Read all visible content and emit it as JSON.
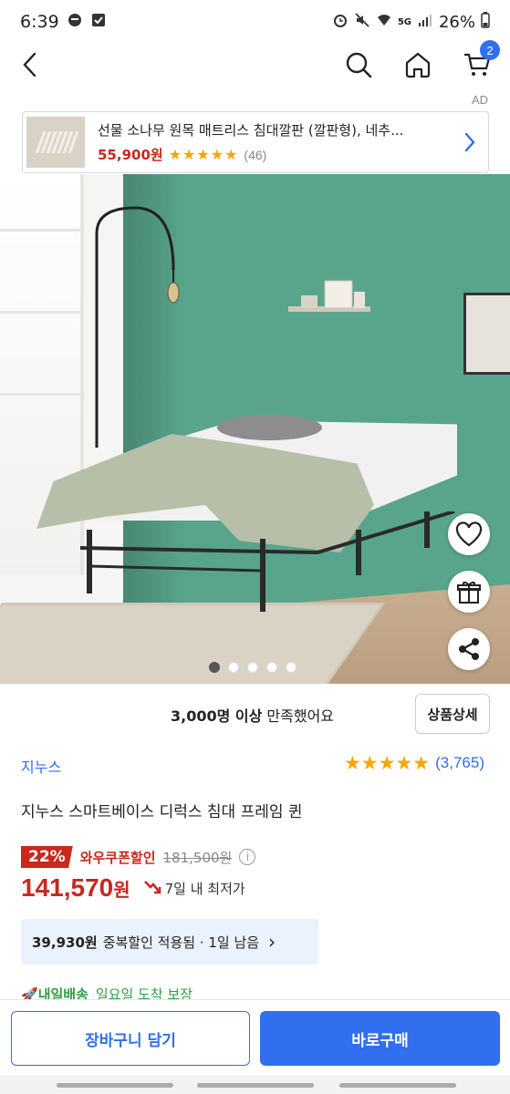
{
  "status_bar": {
    "time": "6:39",
    "battery": "26%",
    "network": "5G"
  },
  "header": {
    "cart_count": "2"
  },
  "ad": {
    "label": "AD",
    "title": "선물 소나무 원목 매트리스 침대깔판 (깔판형), 네추...",
    "price": "55,900원",
    "stars": "★★★★★",
    "review_count": "(46)"
  },
  "gallery": {
    "total": 5,
    "active_index": 0
  },
  "satisfaction": {
    "strong": "3,000명 이상",
    "rest": " 만족했어요"
  },
  "detail_button": "상품상세",
  "product": {
    "brand": "지누스",
    "rating_stars": "★★★★★",
    "review_count": "(3,765)",
    "name": "지누스 스마트베이스 디럭스 침대 프레임 퀸",
    "discount_rate": "22%",
    "coupon_label": "와우쿠폰할인",
    "original_price": "181,500원",
    "price_number": "141,570",
    "price_unit": "원",
    "lowest_label": "7일 내 최저가"
  },
  "extra_discount": {
    "amount": "39,930원",
    "text": "중복할인 적용됨 · 1일 남음",
    "chevron": "›"
  },
  "delivery": {
    "badge": "내일배송",
    "text": "일요일 도착 보장"
  },
  "bottom": {
    "cart_label": "장바구니 담기",
    "buy_label": "바로구매"
  },
  "colors": {
    "accent": "#2f6ff0",
    "price_red": "#c8281e",
    "star": "#f7a600"
  }
}
